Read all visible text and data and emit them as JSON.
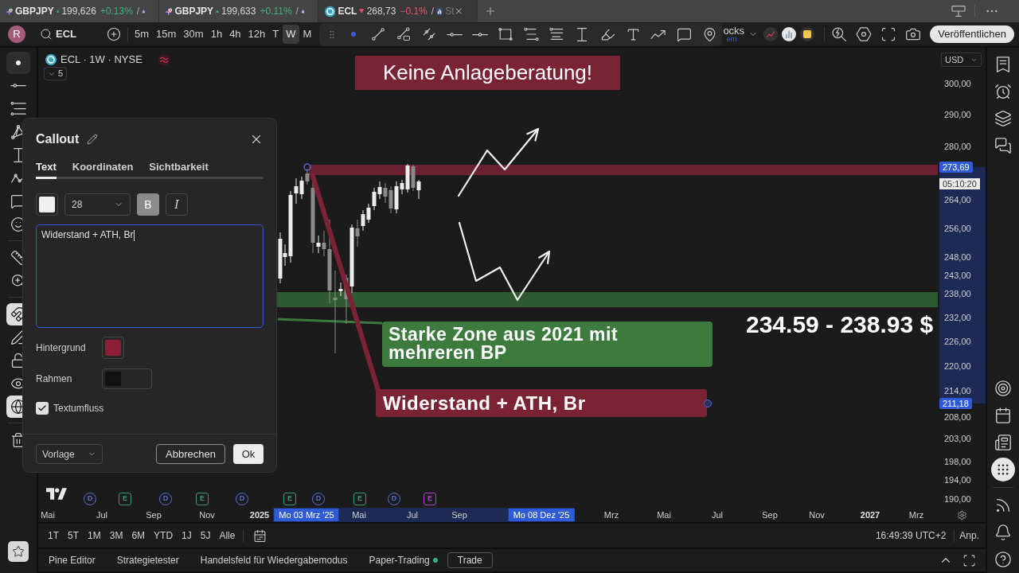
{
  "browser_tabs": [
    {
      "kind": "forex",
      "symbol": "GBPJPY",
      "rising": true,
      "price": "199,626",
      "change": "+0.13%",
      "separator": "/",
      "selected": false
    },
    {
      "kind": "forex",
      "symbol": "GBPJPY",
      "rising": true,
      "price": "199,633",
      "change": "+0.11%",
      "separator": "/",
      "selected": false
    },
    {
      "kind": "stock",
      "symbol": "ECL",
      "rising": false,
      "price": "268,73",
      "change": "−0.1%",
      "separator": "/",
      "suffix": "St",
      "selected": true
    }
  ],
  "toolbar": {
    "avatar": "R",
    "symbol": "ECL",
    "intervals": [
      {
        "label": "5m",
        "selected": false
      },
      {
        "label": "15m",
        "selected": false
      },
      {
        "label": "30m",
        "selected": false
      },
      {
        "label": "1h",
        "selected": false
      },
      {
        "label": "4h",
        "selected": false
      },
      {
        "label": "12h",
        "selected": false
      },
      {
        "label": "T",
        "selected": false
      },
      {
        "label": "W",
        "selected": true
      },
      {
        "label": "M",
        "selected": false
      }
    ],
    "label_fragment": {
      "title": "ocks",
      "subtitle": "ern"
    },
    "publish": "Veröffentlichen"
  },
  "left_toolbar": {
    "tools": [
      {
        "kind": "cursor",
        "selected": true
      },
      {
        "kind": "trend-line",
        "selected": false
      },
      {
        "kind": "fib",
        "selected": false
      },
      {
        "kind": "pattern",
        "selected": false
      },
      {
        "kind": "forecast",
        "selected": false
      },
      {
        "kind": "path",
        "selected": false
      },
      {
        "kind": "annotation",
        "selected": false
      },
      {
        "kind": "emoji",
        "selected": false
      }
    ],
    "toggles": [
      {
        "kind": "magnet",
        "on": true
      },
      {
        "kind": "lock-drawing",
        "on": false
      },
      {
        "kind": "lock",
        "on": false
      },
      {
        "kind": "visibility",
        "on": false
      },
      {
        "kind": "sync",
        "on": true
      }
    ]
  },
  "chart": {
    "legend": {
      "title": "ECL · 1W · NYSE",
      "collapsed_count": "5"
    },
    "banner": "Keine Anlageberatung!",
    "callouts": [
      {
        "kind": "zone",
        "text": "Starke Zone aus 2021 mit mehreren BP",
        "color": "#3d7a3e"
      },
      {
        "kind": "resistance",
        "text": "Widerstand + ATH, Br",
        "color": "#7b2335"
      }
    ],
    "zone_label": "234.59 - 238.93 $",
    "event_markers": [
      {
        "kind": "dividend",
        "label": "D",
        "color": "#5470d6"
      },
      {
        "kind": "earnings",
        "label": "E",
        "color": "#3a9a6c"
      },
      {
        "kind": "dividend",
        "label": "D",
        "color": "#5470d6"
      },
      {
        "kind": "earnings",
        "label": "E",
        "color": "#3a9a6c"
      },
      {
        "kind": "dividend",
        "label": "D",
        "color": "#5470d6"
      },
      {
        "kind": "earnings",
        "label": "E",
        "color": "#3a9a6c"
      },
      {
        "kind": "dividend",
        "label": "D",
        "color": "#5470d6"
      },
      {
        "kind": "earnings",
        "label": "E",
        "color": "#3a9a6c"
      },
      {
        "kind": "dividend",
        "label": "D",
        "color": "#5470d6"
      },
      {
        "kind": "earnings",
        "label": "E",
        "color": "#b13fd6"
      }
    ]
  },
  "price_axis": {
    "currency": "USD",
    "labels": [
      "300,00",
      "290,00",
      "280,00",
      "264,00",
      "256,00",
      "248,00",
      "243,00",
      "238,00",
      "232,00",
      "226,00",
      "220,00",
      "214,00",
      "208,00",
      "203,00",
      "198,00",
      "194,00",
      "190,00"
    ],
    "badges": [
      {
        "kind": "range",
        "text": "273,69"
      },
      {
        "kind": "countdown",
        "text": "05:10:20"
      },
      {
        "kind": "range",
        "text": "211,18"
      }
    ]
  },
  "time_axis": {
    "labels": [
      {
        "kind": "month",
        "text": "Mai"
      },
      {
        "kind": "month",
        "text": "Jul"
      },
      {
        "kind": "month",
        "text": "Sep"
      },
      {
        "kind": "month",
        "text": "Nov"
      },
      {
        "kind": "year",
        "text": "2025"
      },
      {
        "kind": "month",
        "text": "Mai"
      },
      {
        "kind": "month",
        "text": "Jul"
      },
      {
        "kind": "month",
        "text": "Sep"
      },
      {
        "kind": "month",
        "text": "Mrz"
      },
      {
        "kind": "month",
        "text": "Mai"
      },
      {
        "kind": "month",
        "text": "Jul"
      },
      {
        "kind": "month",
        "text": "Sep"
      },
      {
        "kind": "month",
        "text": "Nov"
      },
      {
        "kind": "year",
        "text": "2027"
      },
      {
        "kind": "month",
        "text": "Mrz"
      }
    ],
    "badges": [
      "Mo 03 Mrz '25",
      "Mo 08 Dez '25"
    ]
  },
  "range_bar": {
    "ranges": [
      "1T",
      "5T",
      "1M",
      "3M",
      "6M",
      "YTD",
      "1J",
      "5J",
      "Alle"
    ],
    "clock": "16:49:39 UTC+2",
    "scale_button": "Anp."
  },
  "bottom_panel": {
    "tabs": [
      "Pine Editor",
      "Strategietester",
      "Handelsfeld für Wiedergabemodus"
    ],
    "paper_trading": {
      "label": "Paper-Trading",
      "connected": true
    },
    "trade_button": "Trade"
  },
  "right_sidebar": {
    "top": [
      {
        "kind": "watchlist",
        "selected": false
      },
      {
        "kind": "alerts",
        "selected": false
      },
      {
        "kind": "layers",
        "selected": false
      },
      {
        "kind": "chats",
        "selected": false
      }
    ],
    "bottom": [
      {
        "kind": "target",
        "selected": false
      },
      {
        "kind": "calendar",
        "selected": false
      },
      {
        "kind": "news",
        "selected": false
      },
      {
        "kind": "apps",
        "selected": true
      }
    ],
    "footer": [
      {
        "kind": "broadcast",
        "selected": false
      },
      {
        "kind": "notifications",
        "selected": false
      },
      {
        "kind": "help",
        "selected": false
      }
    ]
  },
  "dialog": {
    "title": "Callout",
    "tabs": [
      {
        "label": "Text",
        "selected": true
      },
      {
        "label": "Koordinaten",
        "selected": false
      },
      {
        "label": "Sichtbarkeit",
        "selected": false
      }
    ],
    "font_size": "28",
    "style_buttons": [
      {
        "kind": "bold",
        "label": "B",
        "selected": true
      },
      {
        "kind": "italic",
        "label": "I",
        "selected": false
      }
    ],
    "text": "Widerstand + ATH, Br",
    "color_fields": [
      {
        "kind": "text",
        "color": "#f0f0f0"
      },
      {
        "kind": "fill",
        "label": "Hintergrund",
        "color": "#8c1e36"
      },
      {
        "kind": "line",
        "label": "Rahmen",
        "color": "#121212"
      }
    ],
    "wrap_option": {
      "label": "Textumfluss",
      "checked": true
    },
    "template": "Vorlage",
    "cancel": "Abbrechen",
    "confirm": "Ok"
  }
}
